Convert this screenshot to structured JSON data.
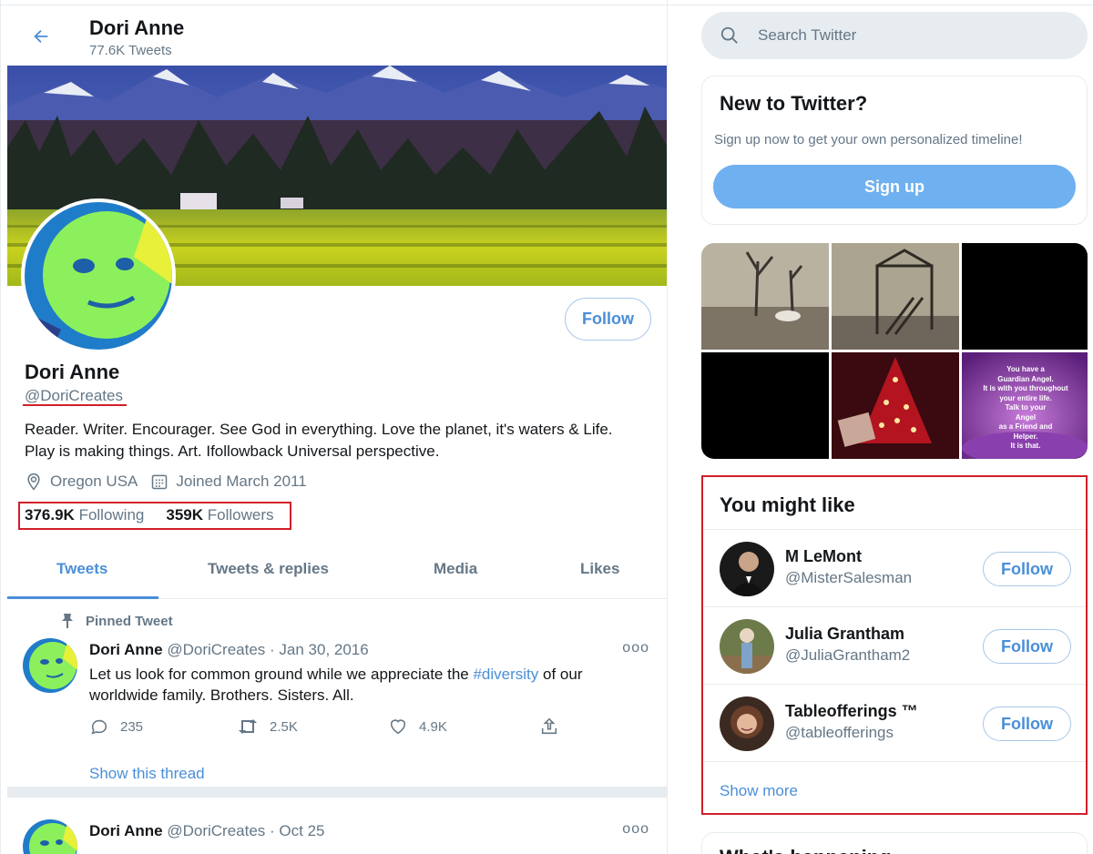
{
  "colors": {
    "accent": "#4a8fd8",
    "signup": "#6fb0f0",
    "highlight": "#d11f2a",
    "muted": "#657786"
  },
  "header": {
    "name": "Dori Anne",
    "tweet_count": "77.6K Tweets",
    "back_icon": "arrow-left-icon"
  },
  "profile": {
    "name": "Dori Anne",
    "handle": "@DoriCreates",
    "follow_label": "Follow",
    "bio_line1": "Reader. Writer. Encourager. See God in everything. Love the planet, it's waters & Life.",
    "bio_line2": "Play is making things. Art. Ifollowback Universal perspective.",
    "location": "Oregon USA",
    "joined": "Joined March 2011",
    "following_count": "376.9K",
    "following_label": "Following",
    "followers_count": "359K",
    "followers_label": "Followers"
  },
  "tabs": [
    {
      "label": "Tweets",
      "active": true
    },
    {
      "label": "Tweets & replies",
      "active": false
    },
    {
      "label": "Media",
      "active": false
    },
    {
      "label": "Likes",
      "active": false
    }
  ],
  "tweets": [
    {
      "pinned_label": "Pinned Tweet",
      "name": "Dori Anne",
      "handle": "@DoriCreates",
      "date": "· Jan 30, 2016",
      "text_before": "Let us look for common ground while we appreciate the ",
      "hashtag": "#diversity",
      "text_after": " of our",
      "text_line2": "worldwide family. Brothers. Sisters. All.",
      "replies": "235",
      "retweets": "2.5K",
      "likes": "4.9K",
      "show_thread": "Show this thread",
      "more": "ooo"
    },
    {
      "name": "Dori Anne",
      "handle": "@DoriCreates",
      "date": "· Oct 25",
      "more": "ooo"
    }
  ],
  "sidebar": {
    "search_placeholder": "Search Twitter",
    "new_title": "New to Twitter?",
    "new_text": "Sign up now to get your own personalized timeline!",
    "signup_label": "Sign up",
    "angel_text": [
      "You have a",
      "Guardian Angel.",
      "It is with you throughout",
      "your entire life.",
      "Talk to your",
      "Angel",
      "as a Friend and",
      "Helper.",
      "It is that."
    ],
    "you_might_like_title": "You might like",
    "suggestions": [
      {
        "name": "M LeMont",
        "handle": "@MisterSalesman",
        "follow_label": "Follow"
      },
      {
        "name": "Julia Grantham",
        "handle": "@JuliaGrantham2",
        "follow_label": "Follow"
      },
      {
        "name": "Tableofferings ™",
        "handle": "@tableofferings",
        "follow_label": "Follow"
      }
    ],
    "show_more": "Show more",
    "trends_title": "What's happening"
  }
}
